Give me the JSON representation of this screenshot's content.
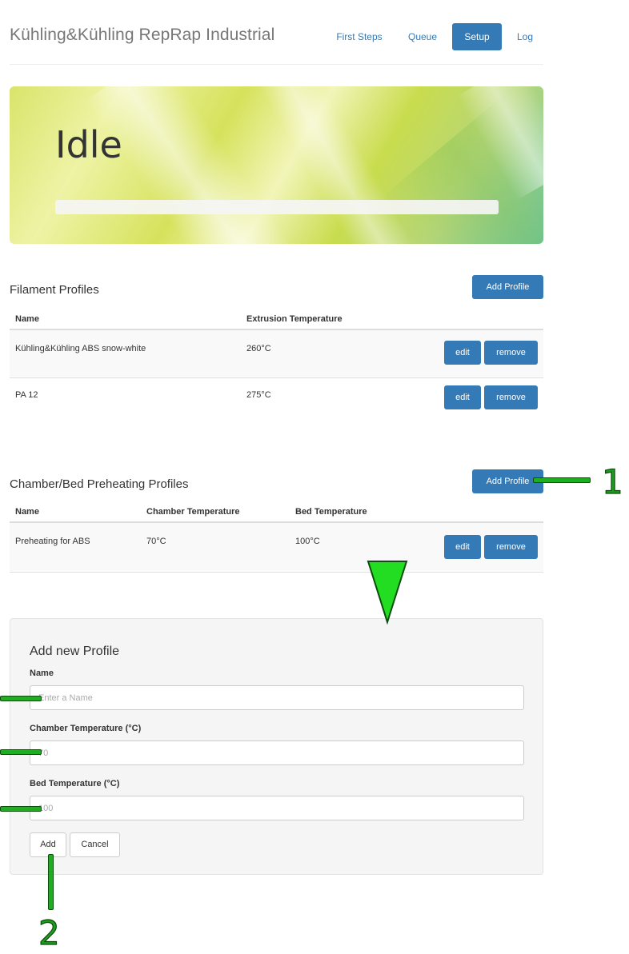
{
  "nav": {
    "brand": "Kühling&Kühling RepRap Industrial",
    "links": [
      {
        "label": "First Steps",
        "active": false
      },
      {
        "label": "Queue",
        "active": false
      },
      {
        "label": "Setup",
        "active": true
      },
      {
        "label": "Log",
        "active": false
      }
    ]
  },
  "status": {
    "state": "Idle",
    "progress": 0
  },
  "filament": {
    "title": "Filament Profiles",
    "add_label": "Add Profile",
    "columns": [
      "Name",
      "Extrusion Temperature"
    ],
    "rows": [
      {
        "name": "Kühling&Kühling ABS snow-white",
        "extrusion_temp": "260°C"
      },
      {
        "name": "PA 12",
        "extrusion_temp": "275°C"
      }
    ],
    "edit_label": "edit",
    "remove_label": "remove"
  },
  "preheating": {
    "title": "Chamber/Bed Preheating Profiles",
    "add_label": "Add Profile",
    "columns": [
      "Name",
      "Chamber Temperature",
      "Bed Temperature"
    ],
    "rows": [
      {
        "name": "Preheating for ABS",
        "chamber_temp": "70°C",
        "bed_temp": "100°C"
      }
    ],
    "edit_label": "edit",
    "remove_label": "remove"
  },
  "form": {
    "title": "Add new Profile",
    "name_label": "Name",
    "name_placeholder": "Enter a Name",
    "chamber_label": "Chamber Temperature (°C)",
    "chamber_placeholder": "70",
    "bed_label": "Bed Temperature (°C)",
    "bed_placeholder": "100",
    "add_label": "Add",
    "cancel_label": "Cancel"
  },
  "annotations": {
    "one": "1",
    "two": "2"
  },
  "colors": {
    "primary": "#337ab7",
    "annotation": "#1fae1f"
  }
}
